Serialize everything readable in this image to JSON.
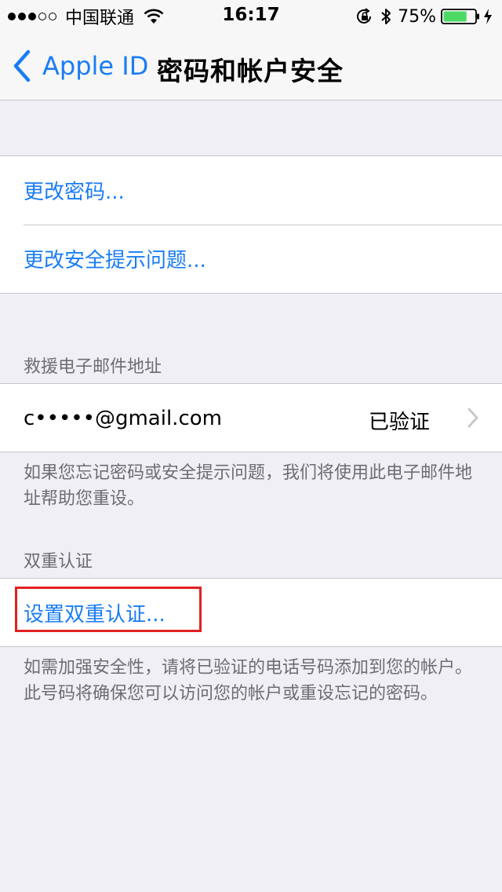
{
  "status_bar": {
    "signal_bars": [
      true,
      true,
      true,
      false,
      false
    ],
    "carrier": "中国联通",
    "time": "16:17",
    "battery_percent": "75%",
    "battery_level": 0.75,
    "battery_color": "#4cd964"
  },
  "nav": {
    "back_label": "Apple ID",
    "title": "密码和帐户安全",
    "accent_color": "#1a7cf5"
  },
  "password_group": {
    "change_password": "更改密码...",
    "change_security_questions": "更改安全提示问题..."
  },
  "rescue_email": {
    "header": "救援电子邮件地址",
    "email": "c•••••@gmail.com",
    "status": "已验证",
    "footer": "如果您忘记密码或安全提示问题，我们将使用此电子邮件地址帮助您重设。"
  },
  "two_factor": {
    "header": "双重认证",
    "setup_label": "设置双重认证...",
    "footer": "如需加强安全性，请将已验证的电话号码添加到您的帐户。此号码将确保您可以访问您的帐户或重设忘记的密码。"
  },
  "icons": {
    "wifi": "wifi-icon",
    "rotation_lock": "rotation-lock-icon",
    "bluetooth": "bluetooth-icon",
    "battery": "battery-icon",
    "charging": "charging-icon",
    "back": "chevron-left-icon",
    "disclosure": "chevron-right-icon"
  }
}
